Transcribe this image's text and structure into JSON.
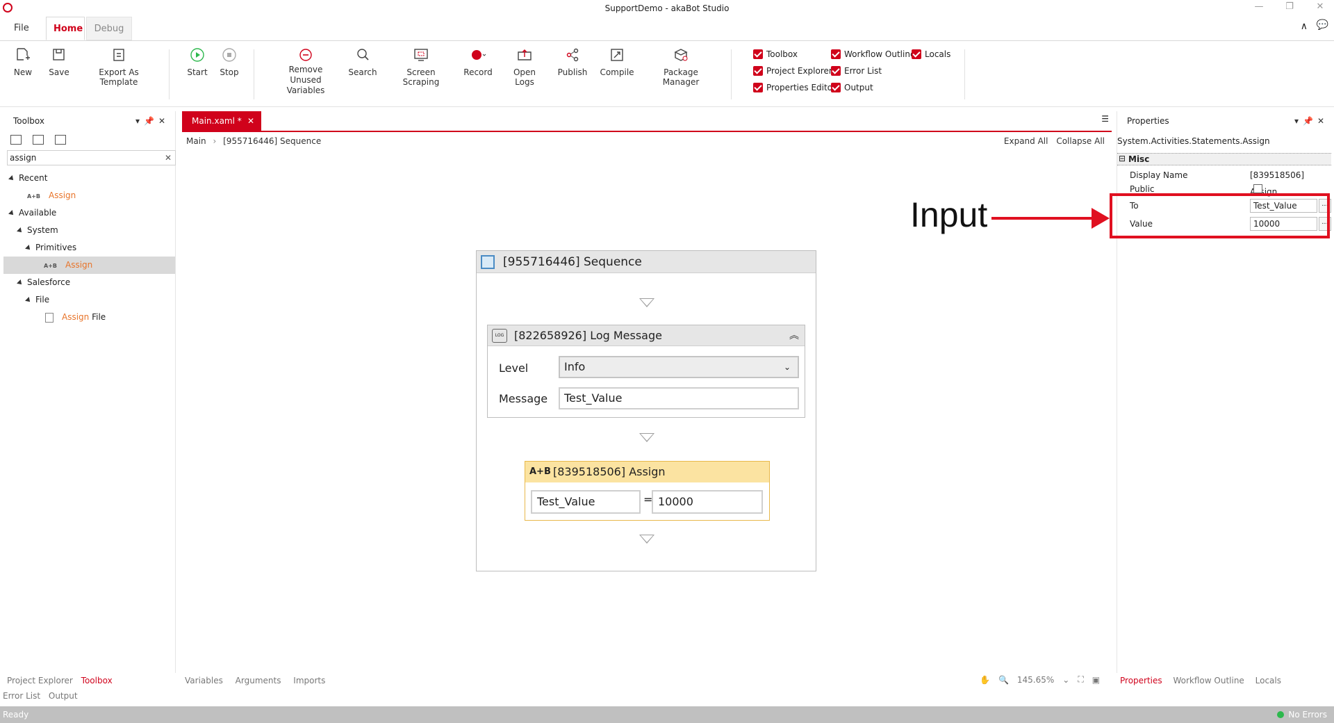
{
  "window": {
    "title": "SupportDemo - akaBot Studio"
  },
  "tabs": {
    "file": "File",
    "home": "Home",
    "debug": "Debug"
  },
  "ribbon": {
    "new": "New",
    "save": "Save",
    "export_template": "Export As Template",
    "start": "Start",
    "stop": "Stop",
    "remove_unused_1": "Remove Unused",
    "remove_unused_2": "Variables",
    "search": "Search",
    "screen_scraping": "Screen Scraping",
    "record": "Record",
    "open_logs": "Open Logs",
    "publish": "Publish",
    "compile": "Compile",
    "package_manager": "Package Manager",
    "checks": {
      "toolbox": "Toolbox",
      "project_explorer": "Project Explorer",
      "properties_editor": "Properties Editor",
      "workflow_outline": "Workflow Outline",
      "error_list": "Error List",
      "output": "Output",
      "locals": "Locals"
    }
  },
  "toolbox": {
    "title": "Toolbox",
    "search_value": "assign",
    "recent": "Recent",
    "recent_item": "Assign",
    "available": "Available",
    "system": "System",
    "primitives": "Primitives",
    "primitives_item": "Assign",
    "salesforce": "Salesforce",
    "file": "File",
    "file_item_hl": "Assign",
    "file_item_rest": " File",
    "ab_label": "A+B"
  },
  "designer": {
    "doc_tab": "Main.xaml *",
    "breadcrumb_root": "Main",
    "breadcrumb_current": "[955716446] Sequence",
    "expand_all": "Expand All",
    "collapse_all": "Collapse All",
    "sequence_title": "[955716446] Sequence",
    "log_title": "[822658926] Log Message",
    "log_icon": "LOG",
    "level_label": "Level",
    "level_value": "Info",
    "message_label": "Message",
    "message_value": "Test_Value",
    "assign_title": "[839518506] Assign",
    "assign_icon": "A+B",
    "assign_to": "Test_Value",
    "assign_eq": "=",
    "assign_value": "10000",
    "bottom_tabs": {
      "variables": "Variables",
      "arguments": "Arguments",
      "imports": "Imports"
    },
    "zoom": "145.65%"
  },
  "properties": {
    "title": "Properties",
    "type": "System.Activities.Statements.Assign",
    "category": "Misc",
    "display_name_label": "Display Name",
    "display_name_value": "[839518506] Assign",
    "public_label": "Public",
    "to_label": "To",
    "to_value": "Test_Value",
    "value_label": "Value",
    "value_value": "10000",
    "ellipsis": "...",
    "bottom_tabs": {
      "properties": "Properties",
      "workflow_outline": "Workflow Outline",
      "locals": "Locals"
    }
  },
  "annotation": {
    "label": "Input"
  },
  "left_bottom": {
    "project_explorer": "Project Explorer",
    "toolbox": "Toolbox",
    "error_list": "Error List",
    "output": "Output"
  },
  "status": {
    "left": "Ready",
    "right": "No Errors"
  }
}
